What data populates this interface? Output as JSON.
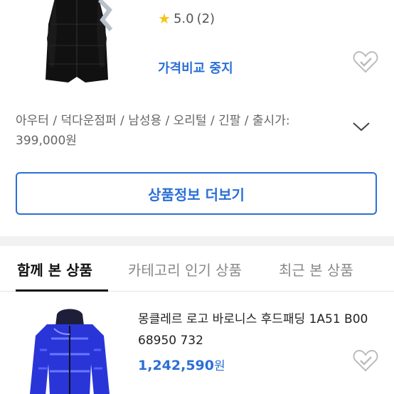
{
  "product": {
    "rating_value": "5.0",
    "rating_count": "(2)",
    "price_compare_label": "가격비교 중지",
    "spec_text": "아우터 / 덕다운점퍼 / 남성용 / 오리털 / 긴팔 / 출시가: 399,000원",
    "detail_button_label": "상품정보 더보기"
  },
  "tabs": [
    {
      "label": "함께 본 상품",
      "active": true
    },
    {
      "label": "카테고리 인기 상품",
      "active": false
    },
    {
      "label": "최근 본 상품",
      "active": false
    }
  ],
  "related_item": {
    "name": "몽클레르 로고 바로니스 후드패딩 1A51 B00 68950 732",
    "price": "1,242,590",
    "price_unit": "원"
  },
  "icons": {
    "rating": "star-icon",
    "wishlist": "heart-check-icon",
    "expand": "chevron-down-icon"
  },
  "colors": {
    "accent": "#2b6fd6",
    "star": "#f5c518",
    "divider": "#f2f2f2"
  }
}
